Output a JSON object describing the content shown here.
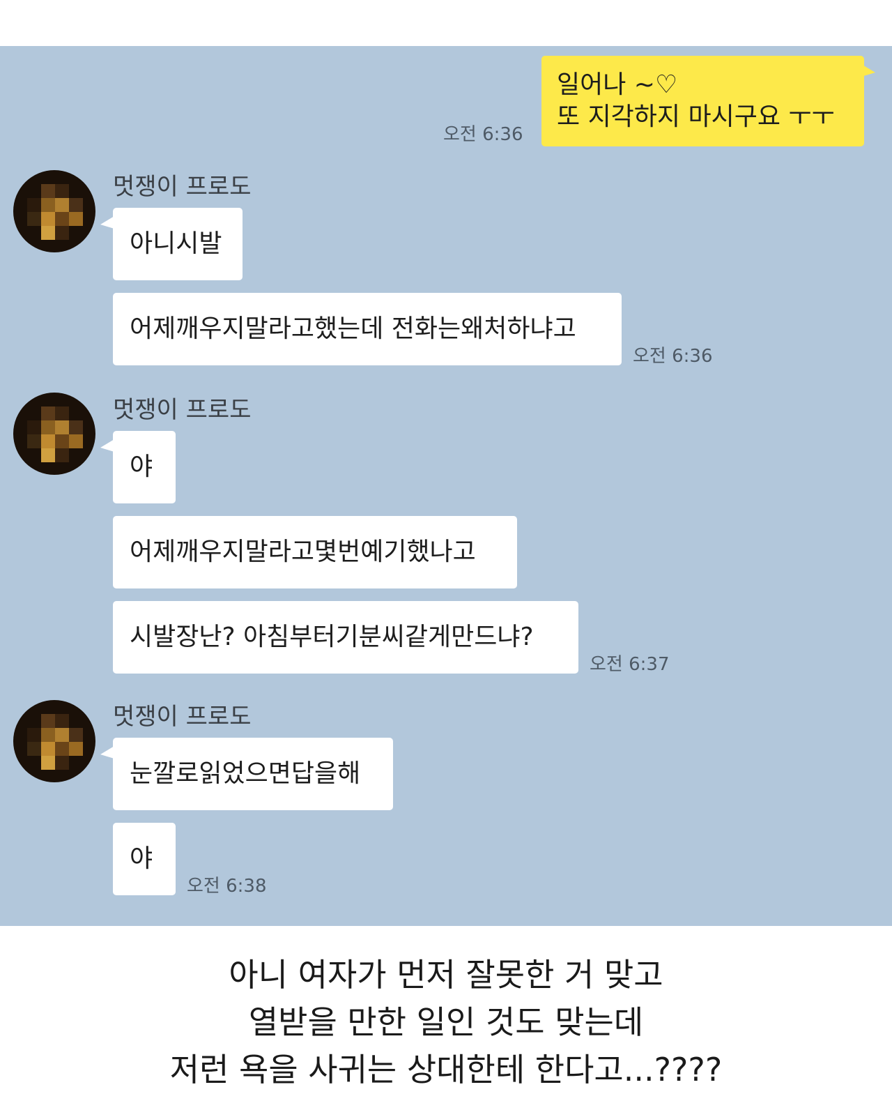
{
  "chat": {
    "my_message": {
      "line1": "일어나 ~♡",
      "line2": "또 지각하지 마시구요 ㅜㅜ",
      "time": "오전 6:36"
    },
    "groups": [
      {
        "sender": "멋쟁이 프로도",
        "messages": [
          "아니시발",
          "어제깨우지말라고했는데 전화는왜처하냐고"
        ],
        "time": "오전 6:36"
      },
      {
        "sender": "멋쟁이 프로도",
        "messages": [
          "야",
          "어제깨우지말라고몇번예기했나고",
          "시발장난? 아침부터기분씨같게만드냐?"
        ],
        "time": "오전 6:37"
      },
      {
        "sender": "멋쟁이 프로도",
        "messages": [
          "눈깔로읽었으면답을해",
          "야"
        ],
        "time": "오전 6:38"
      }
    ]
  },
  "caption": {
    "line1": "아니 여자가 먼저 잘못한 거 맞고",
    "line2": "열받을 만한 일인 것도 맞는데",
    "line3": "저런 욕을 사귀는 상대한테 한다고...????"
  },
  "colors": {
    "chat_background": "#b2c7db",
    "my_bubble": "#fde94a",
    "their_bubble": "#ffffff"
  }
}
